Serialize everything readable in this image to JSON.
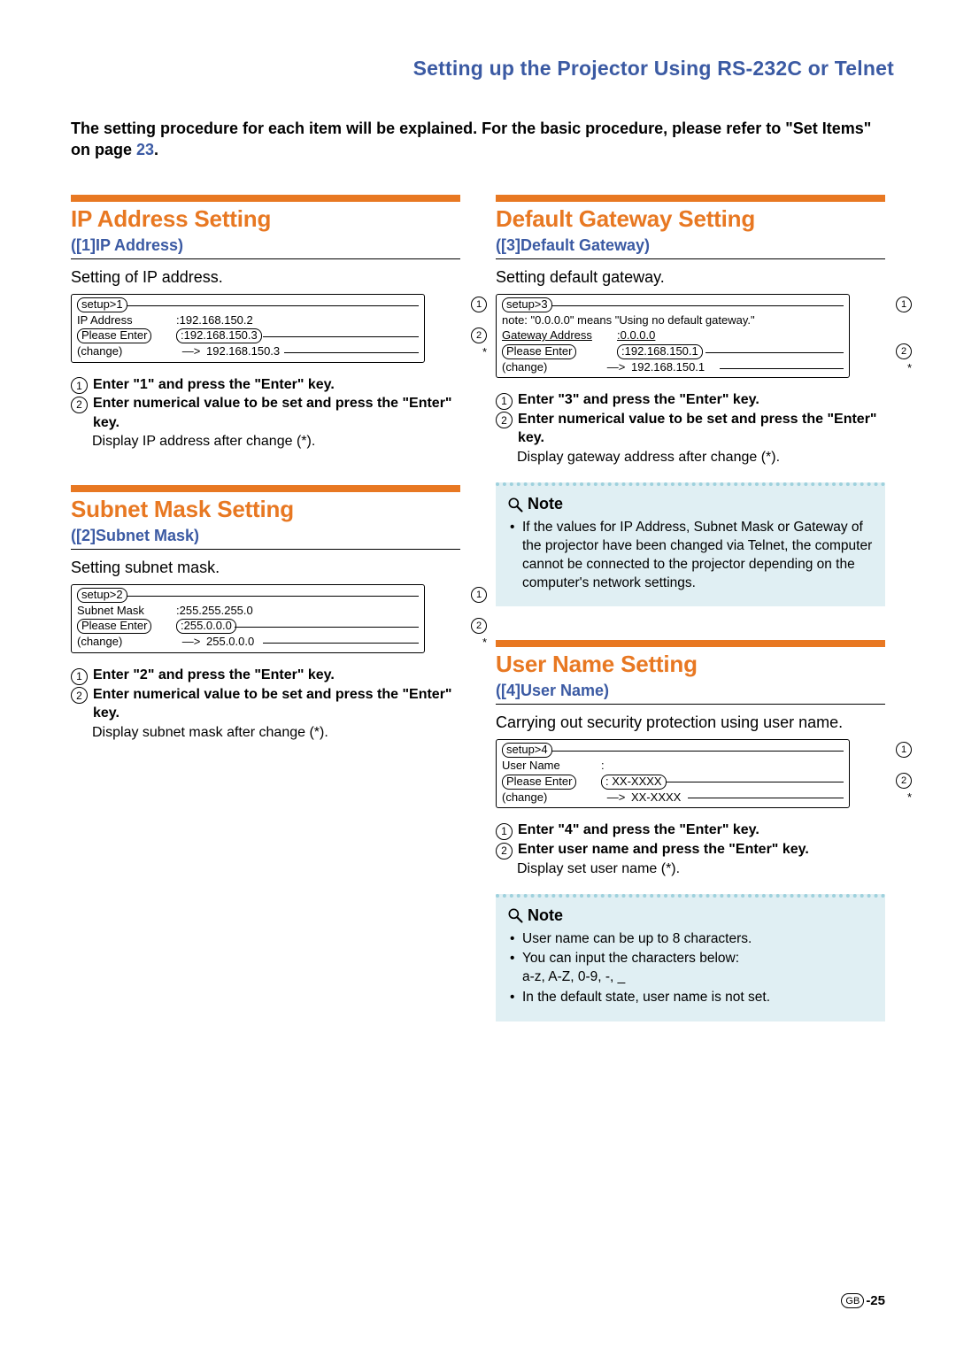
{
  "header": {
    "title": "Setting up the Projector Using RS-232C or Telnet"
  },
  "intro": {
    "text_a": "The setting procedure for each item will be explained. For the basic procedure, please refer to \"Set Items\" on page ",
    "page_link": "23",
    "text_b": "."
  },
  "left": {
    "ip": {
      "title": "IP Address Setting",
      "subtitle": "([1]IP Address)",
      "lead": "Setting of IP address.",
      "term": {
        "r1a": "setup>1",
        "r2a": "IP Address",
        "r2b": ":192.168.150.2",
        "r3a": "Please Enter",
        "r3b": ":192.168.150.3",
        "r4a": "(change)",
        "r4arrow": "—>",
        "r4b": "192.168.150.3"
      },
      "steps": {
        "s1": "Enter \"1\" and press the \"Enter\" key.",
        "s2": "Enter numerical value to be set and press the \"Enter\" key.",
        "after": "Display IP address after change (*)."
      }
    },
    "subnet": {
      "title": "Subnet Mask Setting",
      "subtitle": "([2]Subnet Mask)",
      "lead": "Setting subnet mask.",
      "term": {
        "r1a": "setup>2",
        "r2a": "Subnet Mask",
        "r2b": ":255.255.255.0",
        "r3a": "Please Enter",
        "r3b": ":255.0.0.0",
        "r4a": "(change)",
        "r4arrow": "—>",
        "r4b": "255.0.0.0"
      },
      "steps": {
        "s1": "Enter \"2\" and press the \"Enter\" key.",
        "s2": "Enter numerical value to be set and press the \"Enter\" key.",
        "after": "Display subnet mask after change (*)."
      }
    }
  },
  "right": {
    "gateway": {
      "title": "Default Gateway Setting",
      "subtitle": "([3]Default Gateway)",
      "lead": "Setting default gateway.",
      "term": {
        "r1a": "setup>3",
        "note": "note: \"0.0.0.0\" means \"Using no default gateway.\"",
        "r2a": "Gateway Address",
        "r2b": ":0.0.0.0",
        "r3a": "Please Enter",
        "r3b": ":192.168.150.1",
        "r4a": "(change)",
        "r4arrow": "—>",
        "r4b": "192.168.150.1"
      },
      "steps": {
        "s1": "Enter \"3\" and press the \"Enter\" key.",
        "s2": "Enter numerical value to be set and press the \"Enter\" key.",
        "after": "Display gateway address after change (*)."
      },
      "note": {
        "head": "Note",
        "li1": "If the values for IP Address, Subnet Mask or Gateway of the projector have been changed via Telnet, the computer cannot be connected to the projector depending on the computer's network settings."
      }
    },
    "user": {
      "title": "User Name Setting",
      "subtitle": "([4]User Name)",
      "lead": "Carrying out security protection using user name.",
      "term": {
        "r1a": "setup>4",
        "r2a": "User Name",
        "r2b": ":",
        "r3a": "Please Enter",
        "r3b": ":  XX-XXXX",
        "r4a": "(change)",
        "r4arrow": "—>",
        "r4b": "XX-XXXX"
      },
      "steps": {
        "s1": "Enter \"4\" and press the \"Enter\" key.",
        "s2": "Enter user name and press the \"Enter\" key.",
        "after": "Display set user name (*)."
      },
      "note": {
        "head": "Note",
        "li1": "User name can be up to 8 characters.",
        "li2": "You can input the characters below:",
        "li2b": "a-z, A-Z, 0-9, -, _",
        "li3": "In the default state, user name is not set."
      }
    }
  },
  "footer": {
    "gb": "GB",
    "num": "-25"
  },
  "chart_data": {
    "type": "table",
    "title": "Projector network setup terminal examples",
    "entries": [
      {
        "menu": "[1] IP Address",
        "command": "setup>1",
        "display_label": "IP Address",
        "display_value": "192.168.150.2",
        "input_value": "192.168.150.3",
        "result_value": "192.168.150.3"
      },
      {
        "menu": "[2] Subnet Mask",
        "command": "setup>2",
        "display_label": "Subnet Mask",
        "display_value": "255.255.255.0",
        "input_value": "255.0.0.0",
        "result_value": "255.0.0.0"
      },
      {
        "menu": "[3] Default Gateway",
        "command": "setup>3",
        "note": "\"0.0.0.0\" means \"Using no default gateway.\"",
        "display_label": "Gateway Address",
        "display_value": "0.0.0.0",
        "input_value": "192.168.150.1",
        "result_value": "192.168.150.1"
      },
      {
        "menu": "[4] User Name",
        "command": "setup>4",
        "display_label": "User Name",
        "display_value": "",
        "input_value": "XX-XXXX",
        "result_value": "XX-XXXX"
      }
    ]
  }
}
